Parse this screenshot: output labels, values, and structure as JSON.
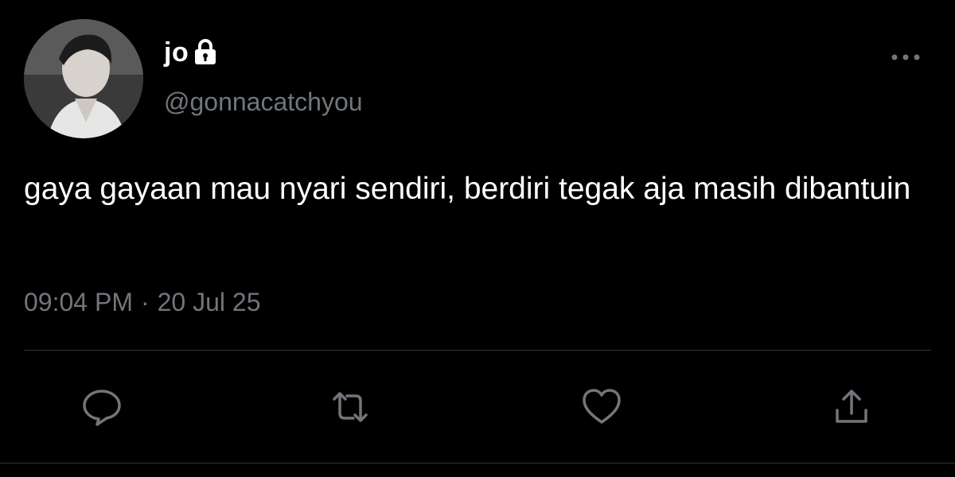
{
  "user": {
    "display_name": "jo",
    "handle": "@gonnacatchyou",
    "protected_icon": "lock-icon",
    "avatar": "profile-photo"
  },
  "tweet": {
    "text": "gaya gayaan mau nyari sendiri, berdiri tegak aja masih dibantuin",
    "time": "09:04 PM",
    "separator": "·",
    "date": "20 Jul 25"
  },
  "actions": [
    {
      "name": "reply",
      "icon": "comment-icon"
    },
    {
      "name": "retweet",
      "icon": "retweet-icon"
    },
    {
      "name": "like",
      "icon": "heart-icon"
    },
    {
      "name": "share",
      "icon": "share-icon"
    }
  ],
  "menu": {
    "icon": "more-icon"
  },
  "colors": {
    "background": "#000000",
    "text": "#ffffff",
    "secondary": "#71767b",
    "divider": "#2f3336"
  }
}
